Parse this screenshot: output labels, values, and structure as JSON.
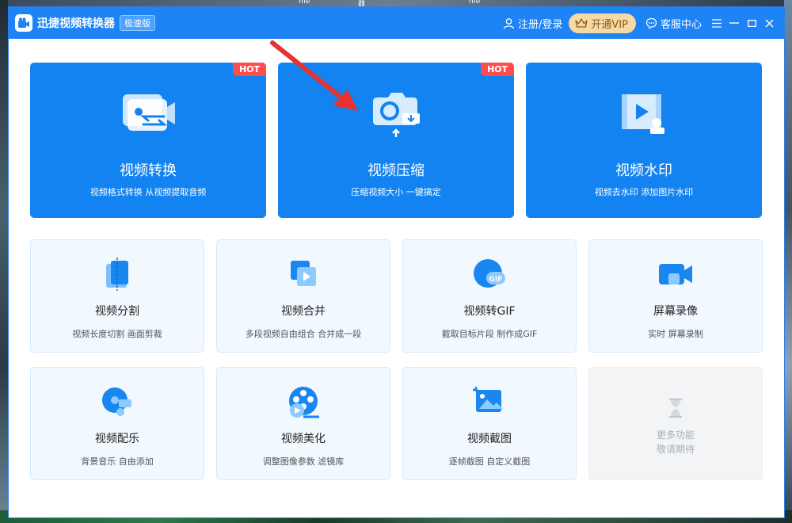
{
  "desktop": {
    "top_labels": [
      "me",
      "器",
      "me"
    ]
  },
  "titlebar": {
    "app_title": "迅捷视频转换器",
    "edition": "极速版",
    "login": "注册/登录",
    "vip": "开通VIP",
    "support": "客服中心"
  },
  "feature_cards": [
    {
      "title": "视频转换",
      "desc": "视频格式转换 从视频提取音频",
      "hot": "HOT"
    },
    {
      "title": "视频压缩",
      "desc": "压缩视频大小 一键搞定",
      "hot": "HOT"
    },
    {
      "title": "视频水印",
      "desc": "视频去水印 添加图片水印"
    }
  ],
  "tools": [
    {
      "title": "视频分割",
      "desc": "视频长度切割 画面剪裁"
    },
    {
      "title": "视频合并",
      "desc": "多段视频自由组合 合并成一段"
    },
    {
      "title": "视频转GIF",
      "desc": "截取目标片段 制作成GIF"
    },
    {
      "title": "屏幕录像",
      "desc": "实时 屏幕录制"
    },
    {
      "title": "视频配乐",
      "desc": "背景音乐 自由添加"
    },
    {
      "title": "视频美化",
      "desc": "调整图像参数 滤镜库"
    },
    {
      "title": "视频截图",
      "desc": "逐帧截图 自定义截图"
    }
  ],
  "more": {
    "line1": "更多功能",
    "line2": "敬请期待"
  },
  "colors": {
    "titlebar": "#1e83f5",
    "card_blue": "#1283f1",
    "hot_red": "#ff4d4f",
    "tile_bg": "#f1f8fe",
    "annotation_arrow": "#e8322f"
  }
}
